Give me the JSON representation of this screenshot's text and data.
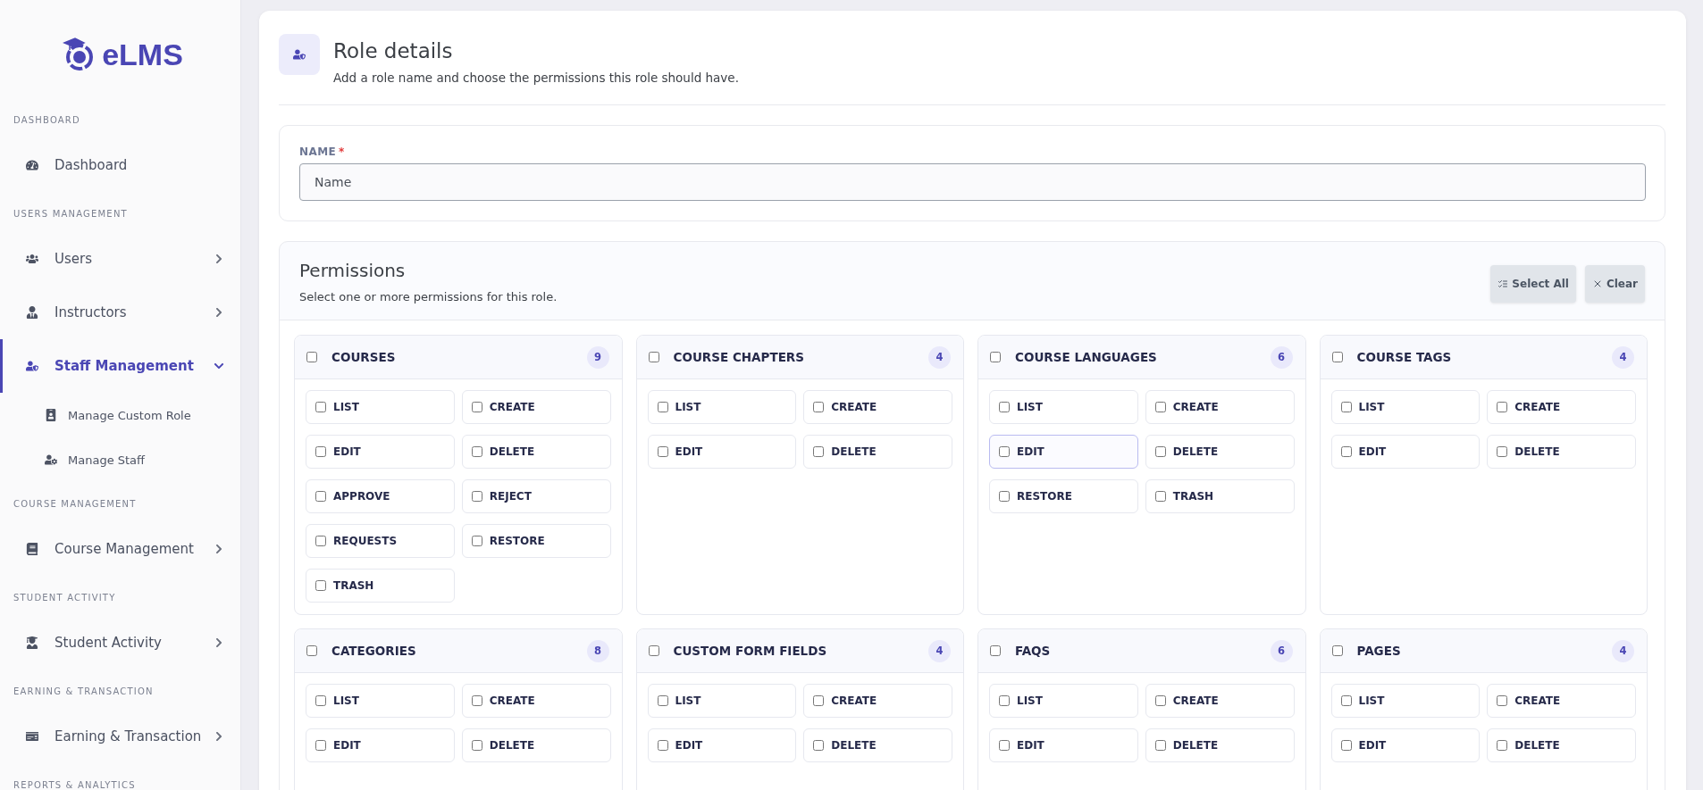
{
  "sidebar": {
    "logo": "eLMS",
    "sections": [
      {
        "label": "DASHBOARD",
        "items": [
          {
            "label": "Dashboard",
            "selected": false,
            "has_arrow": false
          }
        ]
      },
      {
        "label": "USERS MANAGEMENT",
        "items": [
          {
            "label": "Users",
            "selected": false,
            "has_arrow": true,
            "expanded": false
          },
          {
            "label": "Instructors",
            "selected": false,
            "has_arrow": true,
            "expanded": false
          },
          {
            "label": "Staff Management",
            "selected": true,
            "has_arrow": true,
            "expanded": true,
            "children": [
              {
                "label": "Manage Custom Role"
              },
              {
                "label": "Manage Staff"
              }
            ]
          }
        ]
      },
      {
        "label": "COURSE MANAGEMENT",
        "items": [
          {
            "label": "Course Management",
            "selected": false,
            "has_arrow": true,
            "expanded": false
          }
        ]
      },
      {
        "label": "STUDENT ACTIVITY",
        "items": [
          {
            "label": "Student Activity",
            "selected": false,
            "has_arrow": true,
            "expanded": false
          }
        ]
      },
      {
        "label": "EARNING & TRANSACTION",
        "items": [
          {
            "label": "Earning & Transaction",
            "selected": false,
            "has_arrow": true,
            "expanded": false
          }
        ]
      },
      {
        "label": "REPORTS & ANALYTICS"
      }
    ]
  },
  "header": {
    "title": "Role details",
    "subtitle": "Add a role name and choose the permissions this role should have."
  },
  "name_field": {
    "label": "NAME",
    "required_mark": "*",
    "placeholder": "Name"
  },
  "permissions": {
    "title": "Permissions",
    "subtitle": "Select one or more permissions for this role.",
    "buttons": [
      {
        "kind": "select",
        "label": "Select All"
      },
      {
        "kind": "clear",
        "label": "Clear"
      }
    ],
    "groups": [
      {
        "title": "COURSES",
        "count": "9",
        "checked": false,
        "items": [
          {
            "label": "LIST",
            "checked": false,
            "focused": false
          },
          {
            "label": "CREATE",
            "checked": false,
            "focused": false
          },
          {
            "label": "EDIT",
            "checked": false,
            "focused": false
          },
          {
            "label": "DELETE",
            "checked": false,
            "focused": false
          },
          {
            "label": "APPROVE",
            "checked": false,
            "focused": false
          },
          {
            "label": "REJECT",
            "checked": false,
            "focused": false
          },
          {
            "label": "REQUESTS",
            "checked": false,
            "focused": false
          },
          {
            "label": "RESTORE",
            "checked": false,
            "focused": false
          },
          {
            "label": "TRASH",
            "checked": false,
            "focused": false
          }
        ]
      },
      {
        "title": "COURSE CHAPTERS",
        "count": "4",
        "checked": false,
        "items": [
          {
            "label": "LIST",
            "checked": false,
            "focused": false
          },
          {
            "label": "CREATE",
            "checked": false,
            "focused": false
          },
          {
            "label": "EDIT",
            "checked": false,
            "focused": false
          },
          {
            "label": "DELETE",
            "checked": false,
            "focused": false
          }
        ]
      },
      {
        "title": "COURSE LANGUAGES",
        "count": "6",
        "checked": false,
        "items": [
          {
            "label": "LIST",
            "checked": false,
            "focused": false
          },
          {
            "label": "CREATE",
            "checked": false,
            "focused": false
          },
          {
            "label": "EDIT",
            "checked": false,
            "focused": true
          },
          {
            "label": "DELETE",
            "checked": false,
            "focused": false
          },
          {
            "label": "RESTORE",
            "checked": false,
            "focused": false
          },
          {
            "label": "TRASH",
            "checked": false,
            "focused": false
          }
        ]
      },
      {
        "title": "COURSE TAGS",
        "count": "4",
        "checked": false,
        "items": [
          {
            "label": "LIST",
            "checked": false,
            "focused": false
          },
          {
            "label": "CREATE",
            "checked": false,
            "focused": false
          },
          {
            "label": "EDIT",
            "checked": false,
            "focused": false
          },
          {
            "label": "DELETE",
            "checked": false,
            "focused": false
          }
        ]
      },
      {
        "title": "CATEGORIES",
        "count": "8",
        "checked": false,
        "items": [
          {
            "label": "LIST",
            "checked": false,
            "focused": false
          },
          {
            "label": "CREATE",
            "checked": false,
            "focused": false
          },
          {
            "label": "EDIT",
            "checked": false,
            "focused": false
          },
          {
            "label": "DELETE",
            "checked": false,
            "focused": false
          }
        ]
      },
      {
        "title": "CUSTOM FORM FIELDS",
        "count": "4",
        "checked": false,
        "items": [
          {
            "label": "LIST",
            "checked": false,
            "focused": false
          },
          {
            "label": "CREATE",
            "checked": false,
            "focused": false
          },
          {
            "label": "EDIT",
            "checked": false,
            "focused": false
          },
          {
            "label": "DELETE",
            "checked": false,
            "focused": false
          }
        ]
      },
      {
        "title": "FAQS",
        "count": "6",
        "checked": false,
        "items": [
          {
            "label": "LIST",
            "checked": false,
            "focused": false
          },
          {
            "label": "CREATE",
            "checked": false,
            "focused": false
          },
          {
            "label": "EDIT",
            "checked": false,
            "focused": false
          },
          {
            "label": "DELETE",
            "checked": false,
            "focused": false
          }
        ]
      },
      {
        "title": "PAGES",
        "count": "4",
        "checked": false,
        "items": [
          {
            "label": "LIST",
            "checked": false,
            "focused": false
          },
          {
            "label": "CREATE",
            "checked": false,
            "focused": false
          },
          {
            "label": "EDIT",
            "checked": false,
            "focused": false
          },
          {
            "label": "DELETE",
            "checked": false,
            "focused": false
          }
        ]
      }
    ]
  }
}
